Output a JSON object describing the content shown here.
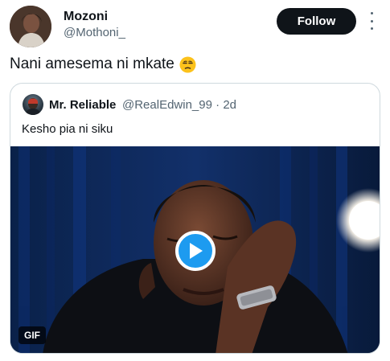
{
  "post": {
    "author_name": "Mozoni",
    "author_handle": "@Mothoni_",
    "follow_label": "Follow",
    "text": "Nani amesema ni mkate",
    "emoji_icon": "unamused-face-icon"
  },
  "quoted": {
    "author_name": "Mr. Reliable",
    "author_handle": "@RealEdwin_99",
    "separator": "·",
    "time": "2d",
    "text": "Kesho pia ni siku",
    "media_badge": "GIF"
  },
  "colors": {
    "accent": "#1d9bf0",
    "text_primary": "#0f1419",
    "text_secondary": "#536471",
    "border": "#cfd9de",
    "follow_bg": "#0f1419"
  }
}
